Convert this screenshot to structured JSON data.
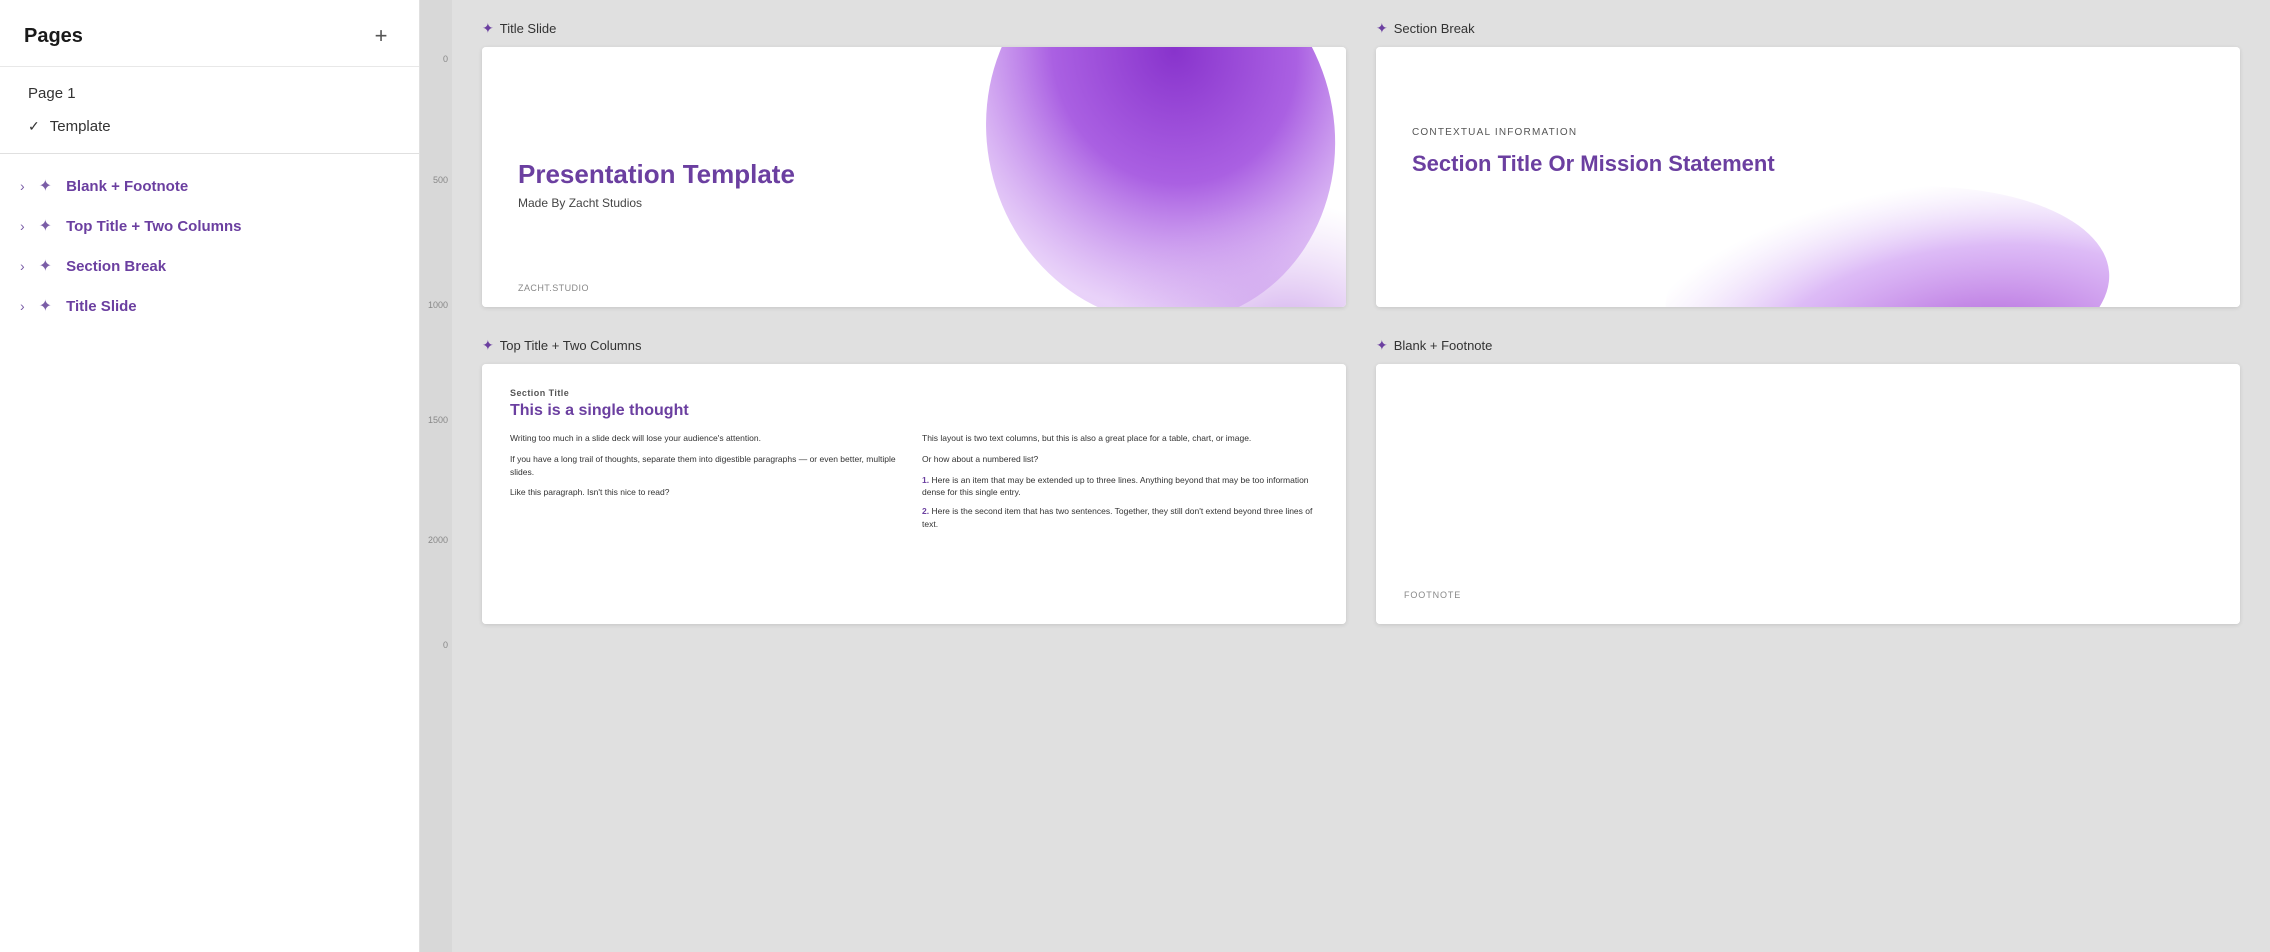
{
  "sidebar": {
    "title": "Pages",
    "add_button_label": "+",
    "pages": [
      {
        "id": "page1",
        "label": "Page 1",
        "active": false,
        "checked": false
      },
      {
        "id": "template",
        "label": "Template",
        "active": true,
        "checked": true
      }
    ],
    "layouts": [
      {
        "id": "blank-footnote",
        "label": "Blank + Footnote"
      },
      {
        "id": "top-title-two-columns",
        "label": "Top Title + Two Columns"
      },
      {
        "id": "section-break",
        "label": "Section Break"
      },
      {
        "id": "title-slide",
        "label": "Title Slide"
      }
    ]
  },
  "canvas": {
    "slides": [
      {
        "id": "title-slide",
        "label": "Title Slide",
        "type": "title",
        "title": "Presentation Template",
        "subtitle": "Made By Zacht Studios",
        "footer": "ZACHT.STUDIO"
      },
      {
        "id": "section-break",
        "label": "Section Break",
        "type": "section",
        "context": "CONTEXTUAL INFORMATION",
        "title": "Section Title Or Mission Statement"
      },
      {
        "id": "top-title-two-columns",
        "label": "Top Title + Two Columns",
        "type": "twocol",
        "section_label": "Section Title",
        "headline": "This is a single thought",
        "col1": [
          "Writing too much in a slide deck will lose your audience's attention.",
          "If you have a long trail of thoughts, separate them into digestible paragraphs — or even better, multiple slides.",
          "Like this paragraph. Isn't this nice to read?"
        ],
        "col2_intro": "This layout is two text columns, but this is also a great place for a table, chart, or image.",
        "col2_question": "Or how about a numbered list?",
        "numbered": [
          {
            "num": "1.",
            "text": "Here is an item that may be extended up to three lines. Anything beyond that may be too information dense for this single entry."
          },
          {
            "num": "2.",
            "text": "Here is the second item that has two sentences. Together, they still don't extend beyond three lines of text."
          }
        ]
      },
      {
        "id": "blank-footnote",
        "label": "Blank + Footnote",
        "type": "blank",
        "footnote": "FOOTNOTE"
      }
    ]
  },
  "ruler": {
    "marks": [
      {
        "value": "0",
        "offset": 54
      },
      {
        "value": "500",
        "offset": 175
      },
      {
        "value": "1000",
        "offset": 300
      },
      {
        "value": "1500",
        "offset": 415
      },
      {
        "value": "2000",
        "offset": 535
      },
      {
        "value": "0",
        "offset": 640
      }
    ]
  },
  "colors": {
    "purple_primary": "#6b3fa0",
    "purple_light": "#9b59d0",
    "purple_blob1": "#8844cc",
    "purple_blob2": "#b57de8",
    "purple_blob3": "#d4aaee"
  }
}
